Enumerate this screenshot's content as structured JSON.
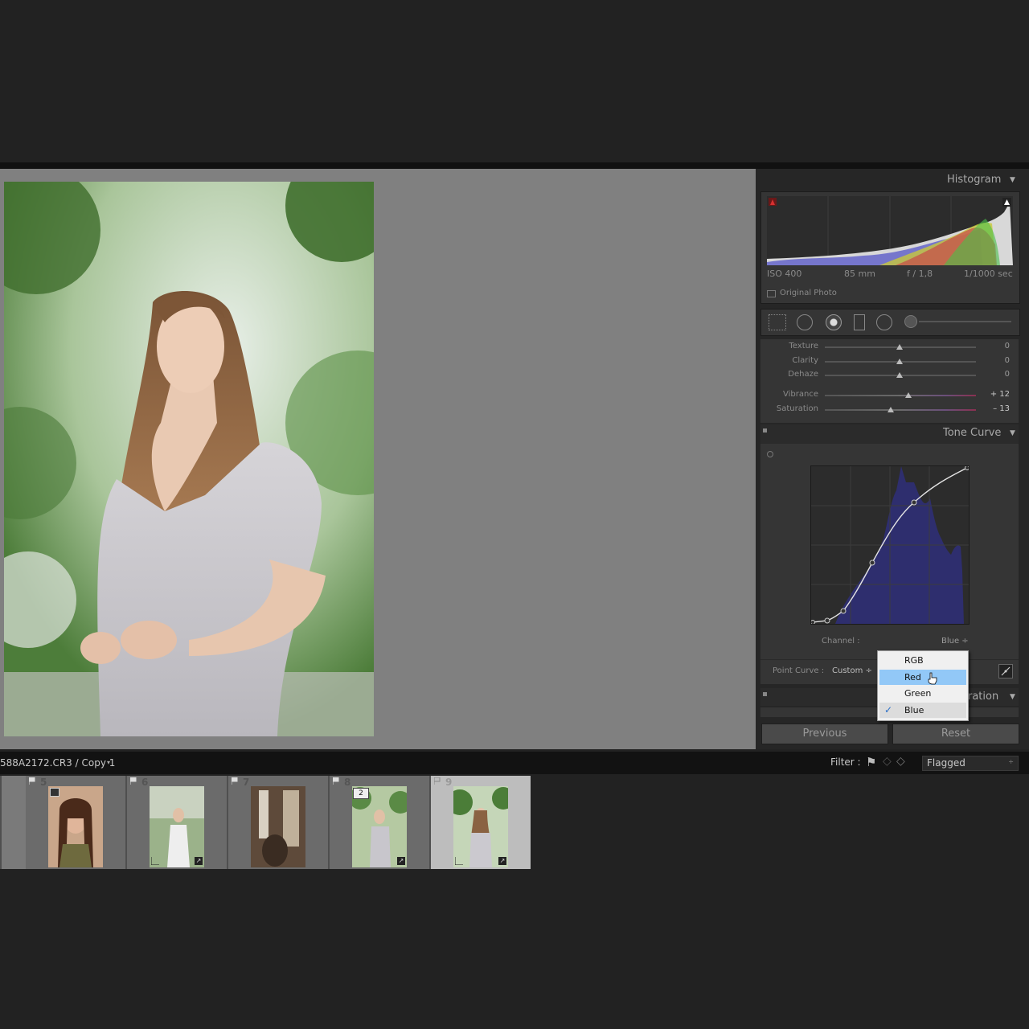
{
  "panel": {
    "histogram_title": "Histogram",
    "exif": {
      "iso": "ISO 400",
      "focal": "85 mm",
      "aperture": "f / 1,8",
      "shutter": "1/1000 sec"
    },
    "original_photo": "Original Photo",
    "sliders": [
      {
        "label": "Texture",
        "value": "0"
      },
      {
        "label": "Clarity",
        "value": "0"
      },
      {
        "label": "Dehaze",
        "value": "0"
      },
      {
        "label": "Vibrance",
        "value": "+ 12"
      },
      {
        "label": "Saturation",
        "value": "– 13"
      }
    ],
    "tone_curve_title": "Tone Curve",
    "channel_label": "Channel :",
    "channel_value": "Blue ÷",
    "point_curve_label": "Point Curve :",
    "point_curve_value": "Custom ÷",
    "calibration_partial": "ration",
    "previous_button": "Previous",
    "reset_button": "Reset"
  },
  "dropdown": {
    "items": [
      {
        "label": "RGB",
        "selected": false,
        "checked": false
      },
      {
        "label": "Red",
        "selected": true,
        "checked": false
      },
      {
        "label": "Green",
        "selected": false,
        "checked": false
      },
      {
        "label": "Blue",
        "selected": false,
        "checked": true
      }
    ]
  },
  "filmstrip": {
    "filename": "588A2172.CR3 / Copy 1",
    "filter_label": "Filter :",
    "filter_value": "Flagged",
    "cells": [
      {
        "number": "5"
      },
      {
        "number": "6"
      },
      {
        "number": "7"
      },
      {
        "number": "8",
        "badge": "2"
      },
      {
        "number": "9"
      }
    ]
  },
  "colors": {
    "accent_selection": "#92c8f7",
    "curve_fill": "#2e2e6e",
    "viewer_bg": "#808080"
  }
}
